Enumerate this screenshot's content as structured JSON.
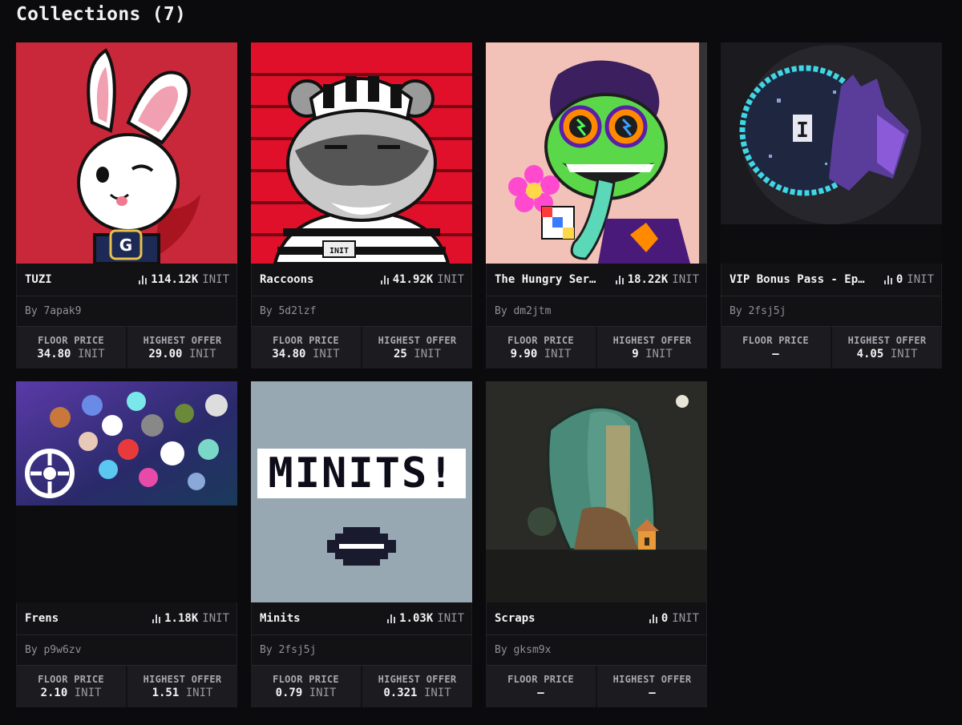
{
  "header": {
    "title": "Collections (7)"
  },
  "labels": {
    "floor": "FLOOR PRICE",
    "offer": "HIGHEST OFFER"
  },
  "collections": [
    {
      "name": "TUZI",
      "volume": "114.12K",
      "unit": "INIT",
      "by": "By 7apak9",
      "floor": "34.80",
      "floor_unit": "INIT",
      "offer": "29.00",
      "offer_unit": "INIT"
    },
    {
      "name": "Raccoons",
      "volume": "41.92K",
      "unit": "INIT",
      "by": "By 5d2lzf",
      "floor": "34.80",
      "floor_unit": "INIT",
      "offer": "25",
      "offer_unit": "INIT"
    },
    {
      "name": "The Hungry Ser…",
      "volume": "18.22K",
      "unit": "INIT",
      "by": "By dm2jtm",
      "floor": "9.90",
      "floor_unit": "INIT",
      "offer": "9",
      "offer_unit": "INIT"
    },
    {
      "name": "VIP Bonus Pass - Ep…",
      "volume": "0",
      "unit": "INIT",
      "by": "By 2fsj5j",
      "floor": "–",
      "floor_unit": "",
      "offer": "4.05",
      "offer_unit": "INIT"
    },
    {
      "name": "Frens",
      "volume": "1.18K",
      "unit": "INIT",
      "by": "By p9w6zv",
      "floor": "2.10",
      "floor_unit": "INIT",
      "offer": "1.51",
      "offer_unit": "INIT"
    },
    {
      "name": "Minits",
      "volume": "1.03K",
      "unit": "INIT",
      "by": "By 2fsj5j",
      "floor": "0.79",
      "floor_unit": "INIT",
      "offer": "0.321",
      "offer_unit": "INIT"
    },
    {
      "name": "Scraps",
      "volume": "0",
      "unit": "INIT",
      "by": "By gksm9x",
      "floor": "–",
      "floor_unit": "",
      "offer": "–",
      "offer_unit": ""
    }
  ],
  "artwork": {
    "tuzi_badge": "G",
    "raccoon_tag": "INIT",
    "vip_glyph": "I",
    "minits_text": "MINITS!"
  },
  "colors": {
    "background": "#0b0b0d",
    "card": "#121215",
    "stat_bg": "#1b1b20",
    "tuzi_bg": "#c8283a",
    "raccoon_bg": "#e0102a",
    "hungry_bg": "#f2c2b8",
    "vip_glow": "#3fd6e6",
    "minits_bg": "#97a8b3",
    "scraps_bg": "#2a2a27"
  }
}
